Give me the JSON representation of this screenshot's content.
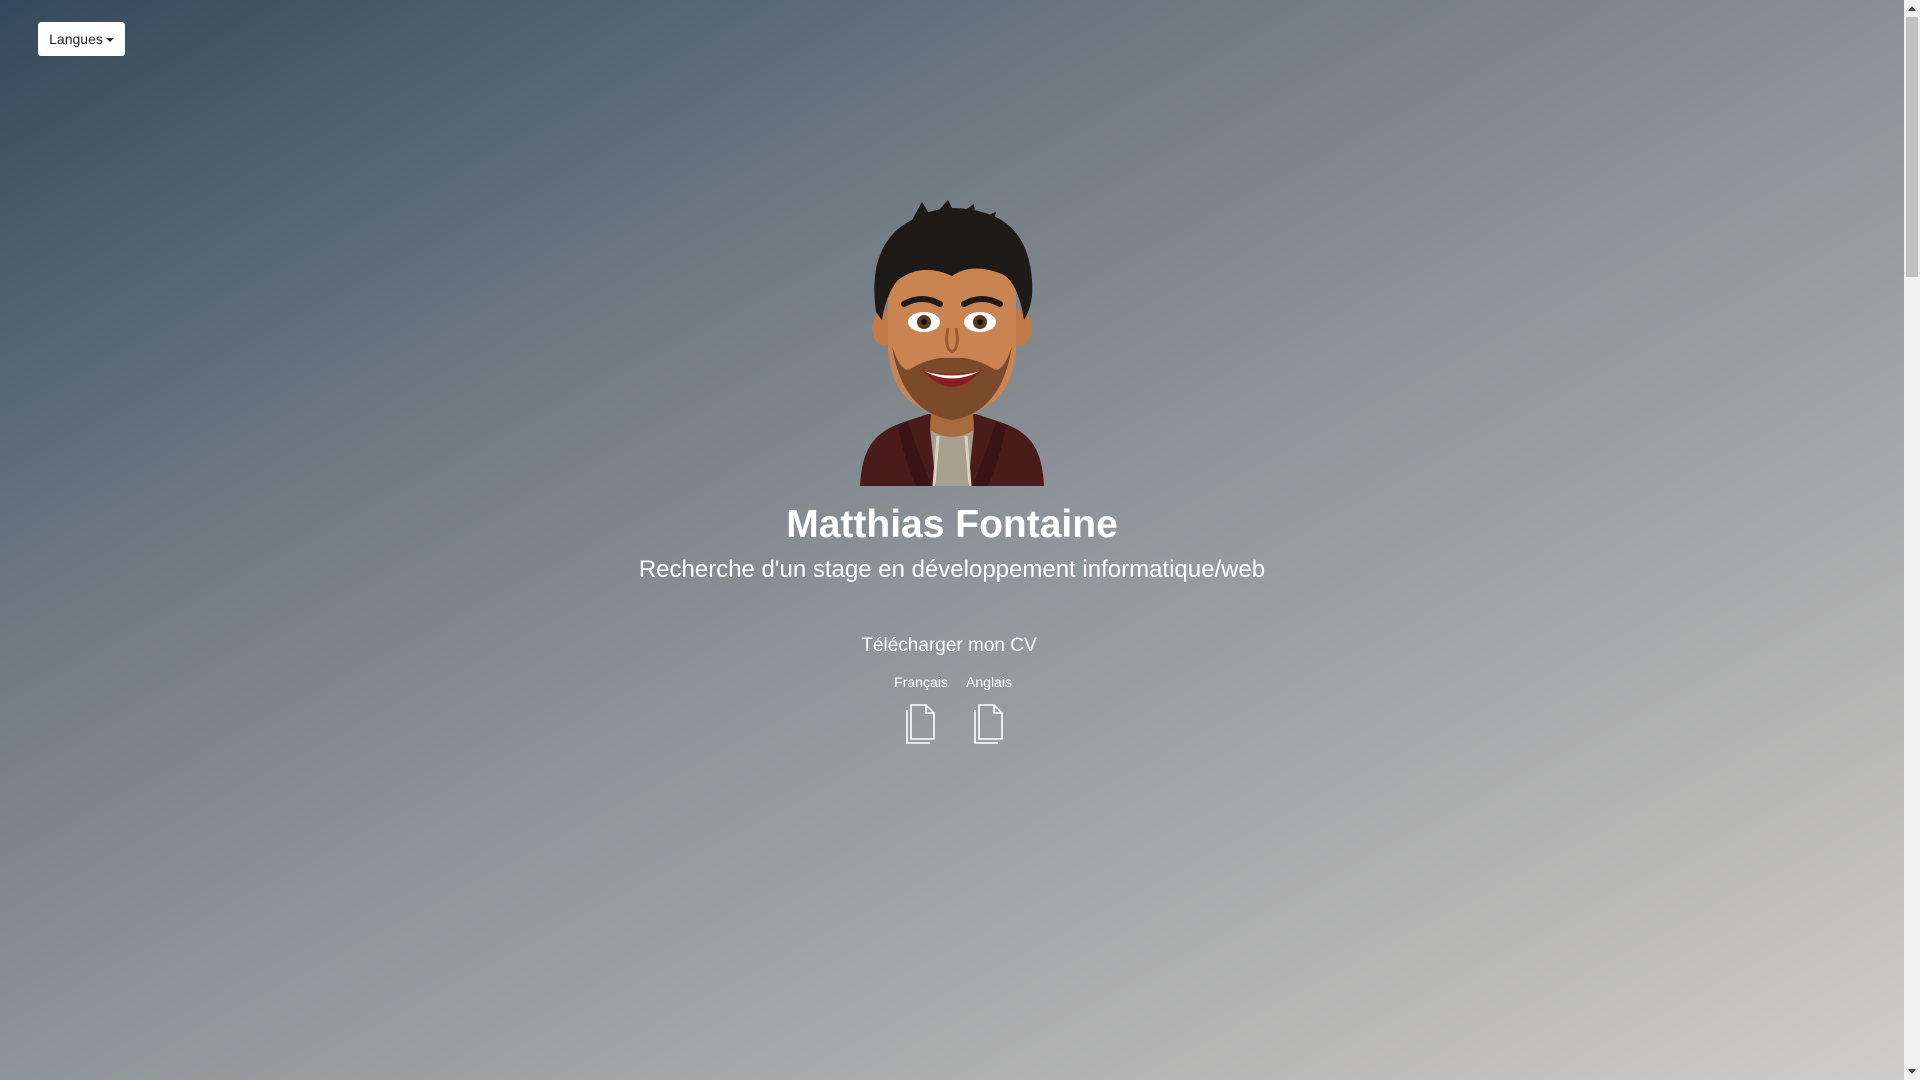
{
  "language_menu": {
    "label": "Langues"
  },
  "profile": {
    "name": "Matthias Fontaine",
    "subtitle": "Recherche d'un stage en développement informatique/web"
  },
  "cv": {
    "title": "Télécharger mon CV",
    "links": [
      {
        "label": "Français",
        "icon": "document-icon"
      },
      {
        "label": "Anglais",
        "icon": "document-icon"
      }
    ]
  },
  "colors": {
    "gradient_start": "#34495b",
    "gradient_end": "#cfcdc9",
    "text": "#ffffff"
  }
}
